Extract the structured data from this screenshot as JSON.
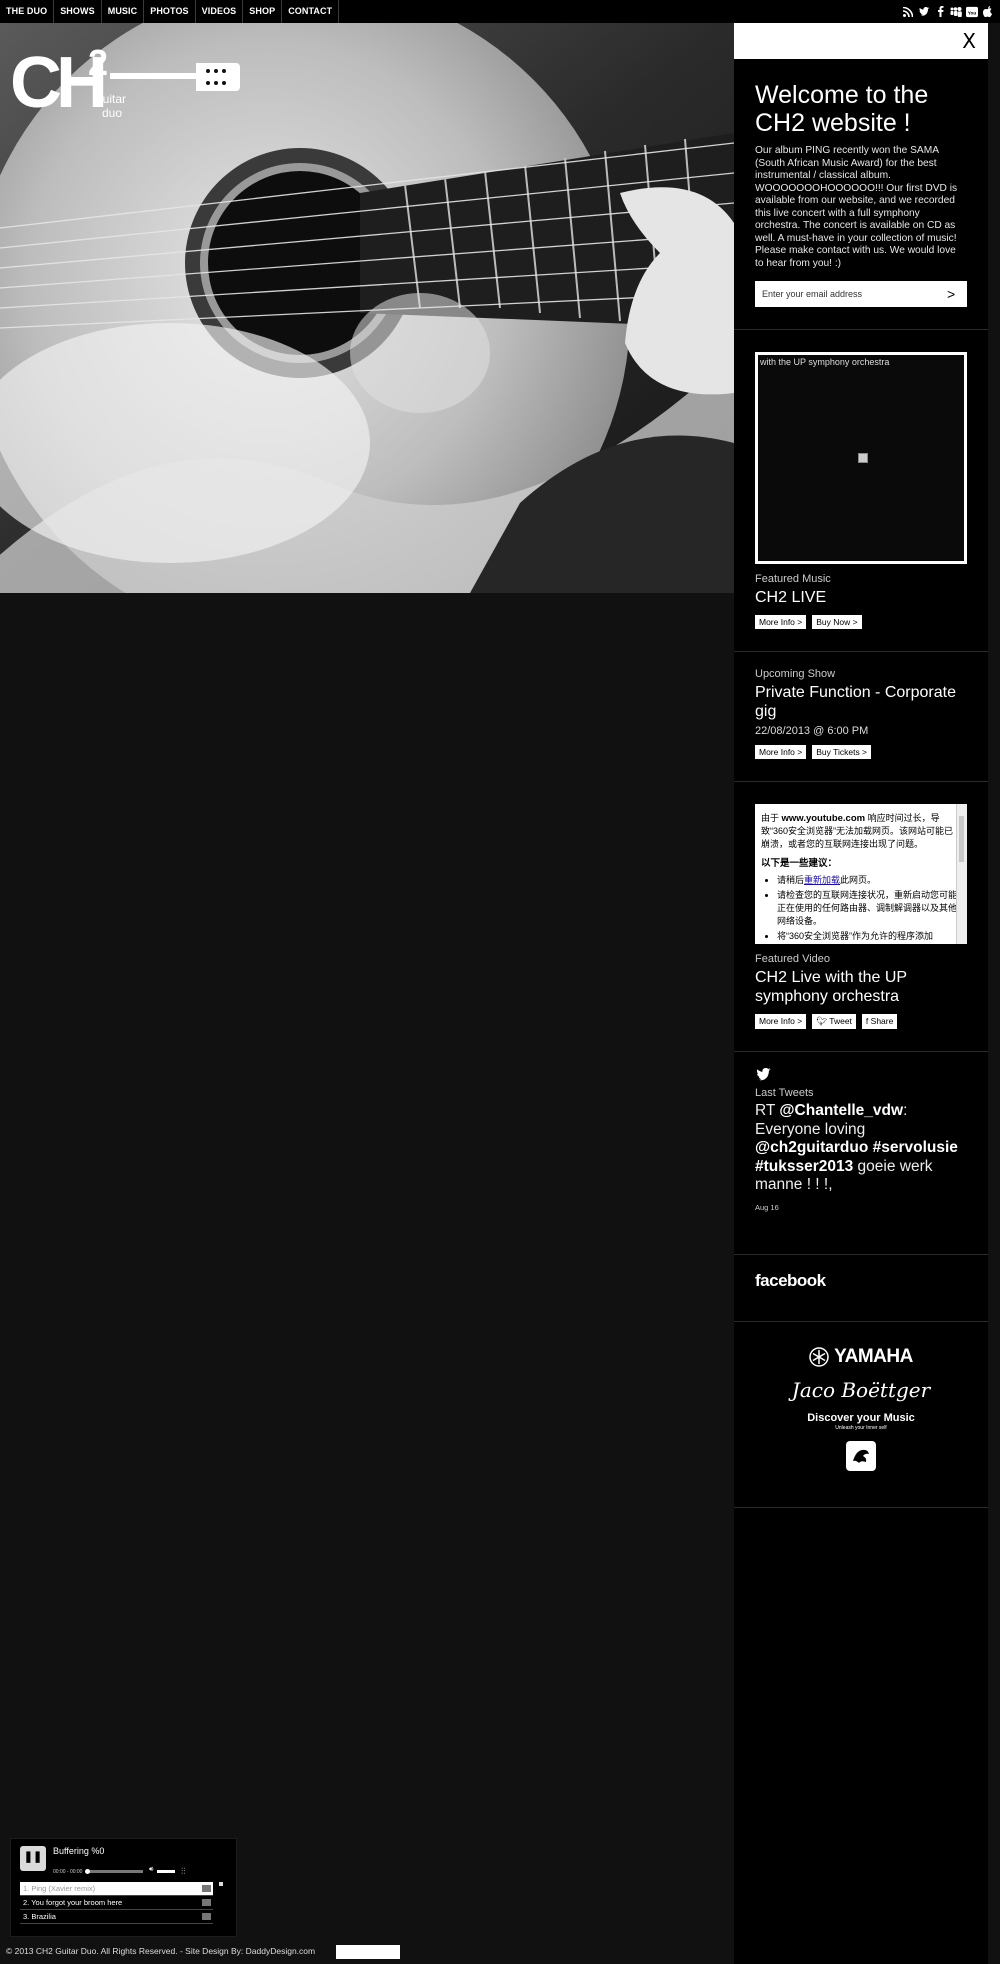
{
  "nav": {
    "items": [
      "THE DUO",
      "SHOWS",
      "MUSIC",
      "PHOTOS",
      "VIDEOS",
      "SHOP",
      "CONTACT"
    ],
    "social_icons": [
      "rss-icon",
      "twitter-icon",
      "facebook-icon",
      "myspace-icon",
      "youtube-icon",
      "apple-icon"
    ]
  },
  "logo": {
    "mark": "CH2",
    "sub1": "guitar",
    "sub2": "duo"
  },
  "sidebar": {
    "close_label": "X",
    "welcome": {
      "title": "Welcome to the CH2 website !",
      "text": "Our album PING recently won the SAMA (South African Music Award) for the best instrumental / classical album. WOOOOOOOHOOOOOO!!! Our first DVD is available from our website, and we recorded this live concert with a full symphony orchestra. The concert is available on CD as well. A must-have in your collection of music! Please make contact with us. We would love to hear from you! :)",
      "email_placeholder": "Enter your email address",
      "submit_label": ">"
    },
    "music": {
      "video_caption": "with the UP symphony orchestra",
      "label": "Featured Music",
      "title": "CH2 LIVE",
      "more_info": "More Info >",
      "buy_now": "Buy Now >"
    },
    "show": {
      "label": "Upcoming Show",
      "title": "Private Function - Corporate gig",
      "datetime": "22/08/2013 @ 6:00 PM",
      "more_info": "More Info >",
      "buy_tickets": "Buy Tickets >"
    },
    "video": {
      "error_line1_prefix": "由于 ",
      "error_url": "www.youtube.com",
      "error_line1_rest": " 响应时间过长，导致“360安全浏览器”无法加载网页。该网站可能已崩溃，或者您的互联网连接出现了问题。",
      "suggest_title": "以下是一些建议：",
      "suggest1_pre": "请稍后",
      "suggest1_link": "重新加载",
      "suggest1_post": "此网页。",
      "suggest2": "请检查您的互联网连接状况，重新启动您可能正在使用的任何路由器、调制解调器以及其他网络设备。",
      "suggest3": "将“360安全浏览器”作为允许的程序添加",
      "label": "Featured Video",
      "title": "CH2 Live with the UP symphony orchestra",
      "more_info": "More Info >",
      "tweet": "Tweet",
      "share": "Share"
    },
    "tweets": {
      "label": "Last Tweets",
      "rt": "RT ",
      "mention": "@Chantelle_vdw",
      "colon": ": Everyone loving ",
      "handle": "@ch2guitarduo",
      "tag1": "#servolusie",
      "tag2": "#tuksser2013",
      "rest": " goeie werk manne ! ! !,",
      "date": "Aug 16"
    },
    "facebook": "facebook",
    "sponsors": [
      "YAMAHA",
      "Jaco Boëttger",
      "Discover your Music",
      "Unleash your Inner self"
    ]
  },
  "player": {
    "status": "Buffering %0",
    "time": "00:00 - 00:00",
    "tracks": [
      "1. Ping (Xavier remix)",
      "2. You forgot your broom here",
      "3. Brazilia"
    ]
  },
  "footer": {
    "text": "© 2013 CH2 Guitar Duo. All Rights Reserved.  -  Site Design By: DaddyDesign.com"
  }
}
